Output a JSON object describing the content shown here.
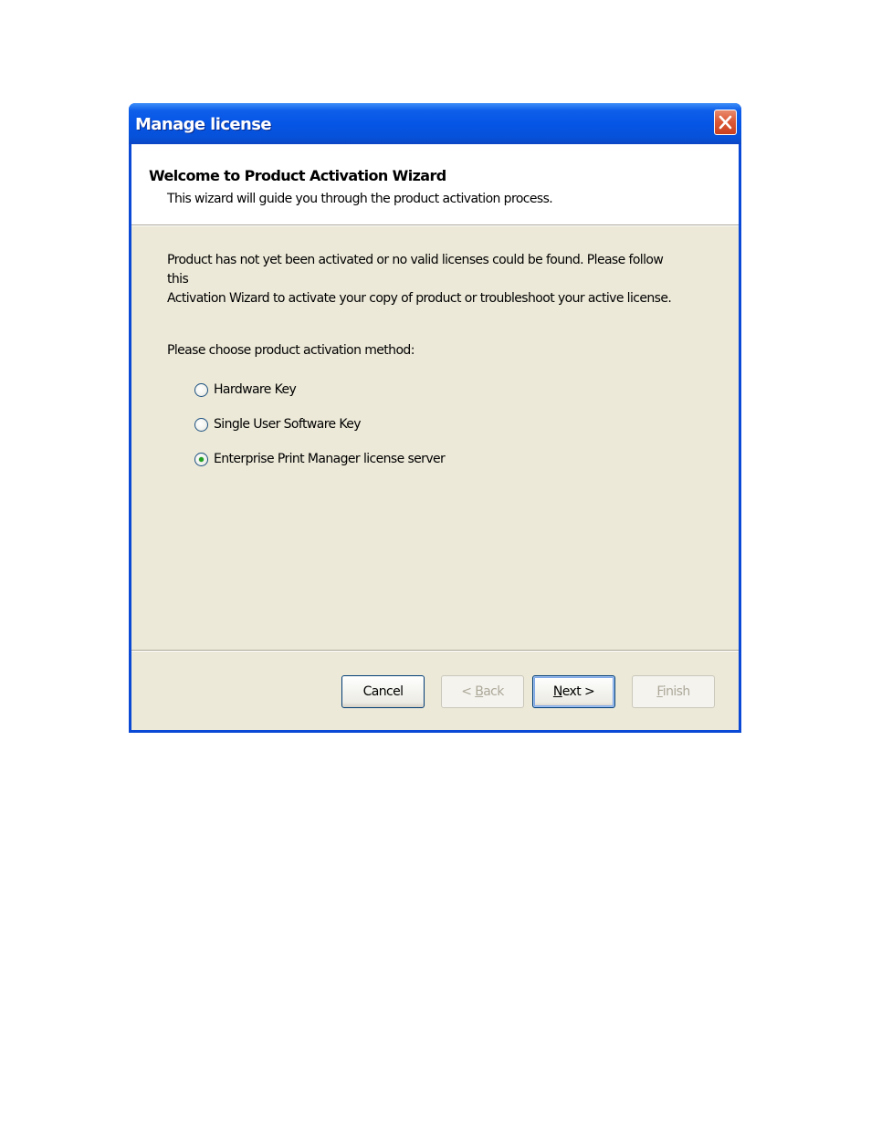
{
  "window": {
    "title": "Manage license"
  },
  "header": {
    "title": "Welcome to Product Activation Wizard",
    "subtitle": "This wizard will guide you through the product activation process."
  },
  "body": {
    "description_line1": "Product has not yet been activated or no valid licenses could be found. Please follow this",
    "description_line2": "Activation Wizard to activate your copy of product or troubleshoot your active license.",
    "prompt": "Please choose product activation method:",
    "options": [
      {
        "label": "Hardware Key",
        "selected": false
      },
      {
        "label": "Single User Software Key",
        "selected": false
      },
      {
        "label": "Enterprise Print Manager license server",
        "selected": true
      }
    ]
  },
  "buttons": {
    "cancel": "Cancel",
    "back_mnemonic": "B",
    "back_rest": "ack",
    "back_prefix": "< ",
    "next_mnemonic": "N",
    "next_rest": "ext >",
    "finish_mnemonic": "F",
    "finish_rest": "inish"
  },
  "icons": {
    "close": "close-icon",
    "radio": "radio-button"
  },
  "colors": {
    "titlebar": "#0655e6",
    "client_background": "#ece9d8",
    "close_button": "#dc5a38",
    "radio_dot": "#21a121"
  }
}
